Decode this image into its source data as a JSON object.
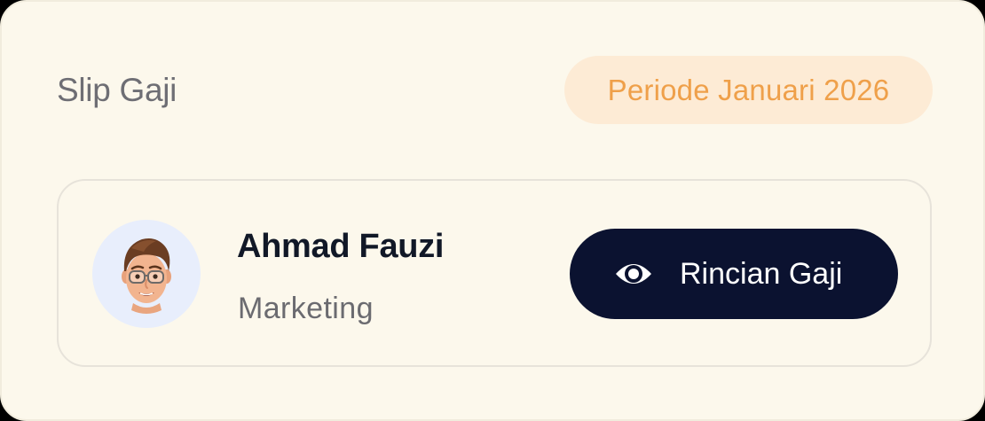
{
  "header": {
    "title": "Slip Gaji",
    "period_badge": "Periode Januari 2026"
  },
  "employee": {
    "avatar_icon": "memoji-avatar-icon",
    "name": "Ahmad Fauzi",
    "department": "Marketing"
  },
  "actions": {
    "detail_button_label": "Rincian Gaji",
    "detail_button_icon": "eye-icon"
  },
  "colors": {
    "card_background": "#fcf8ec",
    "badge_background": "#fdebd5",
    "badge_text": "#efa04a",
    "button_background": "#0b1230",
    "avatar_background": "#e8eefc"
  }
}
